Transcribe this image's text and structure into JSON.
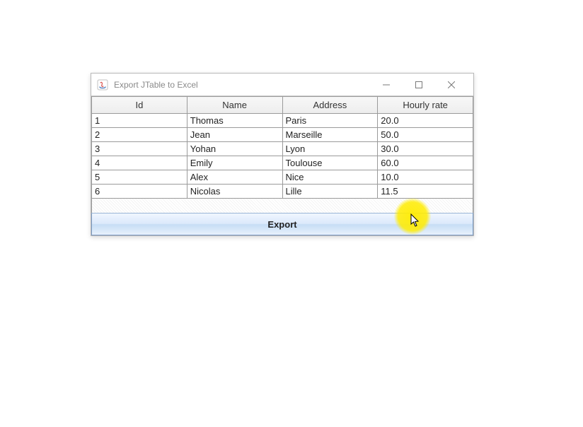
{
  "window": {
    "title": "Export JTable to Excel"
  },
  "table": {
    "headers": [
      "Id",
      "Name",
      "Address",
      "Hourly rate"
    ],
    "rows": [
      {
        "id": "1",
        "name": "Thomas",
        "address": "Paris",
        "rate": "20.0"
      },
      {
        "id": "2",
        "name": "Jean",
        "address": "Marseille",
        "rate": "50.0"
      },
      {
        "id": "3",
        "name": "Yohan",
        "address": "Lyon",
        "rate": "30.0"
      },
      {
        "id": "4",
        "name": "Emily",
        "address": "Toulouse",
        "rate": "60.0"
      },
      {
        "id": "5",
        "name": "Alex",
        "address": "Nice",
        "rate": "10.0"
      },
      {
        "id": "6",
        "name": "Nicolas",
        "address": "Lille",
        "rate": "11.5"
      }
    ]
  },
  "actions": {
    "export_label": "Export"
  }
}
